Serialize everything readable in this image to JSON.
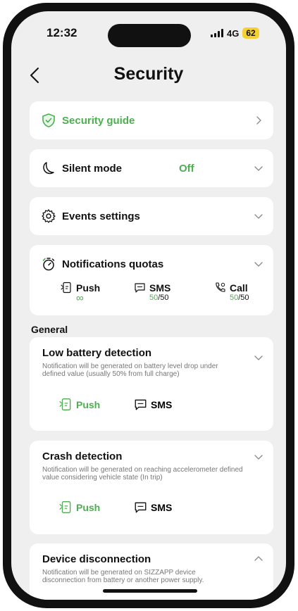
{
  "status": {
    "time": "12:32",
    "network": "4G",
    "battery": "62"
  },
  "header": {
    "title": "Security"
  },
  "menu": {
    "security_guide": "Security guide",
    "silent_mode": "Silent mode",
    "silent_mode_value": "Off",
    "events_settings": "Events settings",
    "notifications_quotas": "Notifications quotas"
  },
  "quotas": {
    "push": {
      "label": "Push",
      "value": "∞"
    },
    "sms": {
      "label": "SMS",
      "used": "50",
      "total": "/50"
    },
    "call": {
      "label": "Call",
      "used": "50",
      "total": "/50"
    }
  },
  "general": {
    "label": "General",
    "items": [
      {
        "title": "Low battery detection",
        "description": "Notification will be generated on battery level drop under defined value (usually 50% from full charge)",
        "push": "Push",
        "sms": "SMS"
      },
      {
        "title": "Crash detection",
        "description": "Notification will be generated on reaching accelerometer defined value considering vehicle state (In trip)",
        "push": "Push",
        "sms": "SMS"
      },
      {
        "title": "Device disconnection",
        "description": "Notification will be generated on SIZZAPP device disconnection from battery or another power supply."
      }
    ]
  },
  "colors": {
    "accent": "#4caf50",
    "battery": "#f5d033",
    "background": "#efefef"
  }
}
